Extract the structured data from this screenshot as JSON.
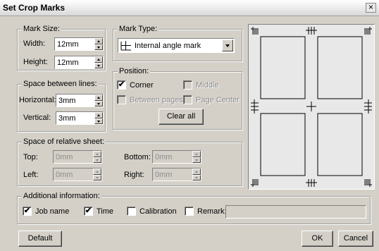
{
  "window": {
    "title": "Set Crop Marks",
    "close_label": "×"
  },
  "mark_size": {
    "legend": "Mark Size:",
    "width_label": "Width:",
    "width_value": "12mm",
    "height_label": "Height:",
    "height_value": "12mm"
  },
  "mark_type": {
    "legend": "Mark Type:",
    "selected": "Internal angle mark"
  },
  "position": {
    "legend": "Position:",
    "corner": {
      "label": "Corner",
      "checked": "✔"
    },
    "middle": {
      "label": "Middle",
      "checked": ""
    },
    "between_pages": {
      "label": "Between pages",
      "checked": ""
    },
    "page_center": {
      "label": "Page Center",
      "checked": ""
    },
    "clear_all_label": "Clear all"
  },
  "space_between_lines": {
    "legend": "Space between lines:",
    "horizontal_label": "Horizontal:",
    "horizontal_value": "3mm",
    "vertical_label": "Vertical:",
    "vertical_value": "3mm"
  },
  "relative_sheet": {
    "legend": "Space of relative sheet:",
    "top_label": "Top:",
    "top_value": "0mm",
    "bottom_label": "Bottom:",
    "bottom_value": "0mm",
    "left_label": "Left:",
    "left_value": "0mm",
    "right_label": "Right:",
    "right_value": "0mm"
  },
  "additional_info": {
    "legend": "Additional information:",
    "job_name": {
      "label": "Job name",
      "checked": "✔"
    },
    "time": {
      "label": "Time",
      "checked": "✔"
    },
    "calibration": {
      "label": "Calibration",
      "checked": ""
    },
    "remark": {
      "label": "Remark:",
      "checked": "",
      "value": ""
    }
  },
  "buttons": {
    "default_label": "Default",
    "ok_label": "OK",
    "cancel_label": "Cancel"
  },
  "colors": {
    "dialog_bg": "#d4d0c8",
    "selection": "#0a246a",
    "corner_marker": "#808080"
  }
}
